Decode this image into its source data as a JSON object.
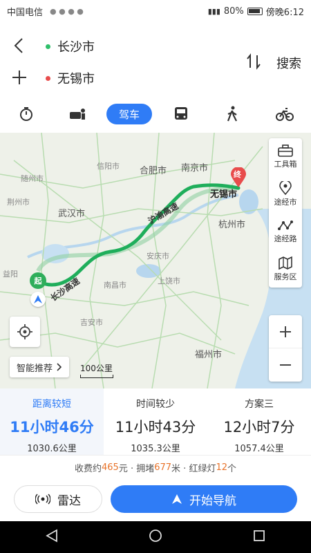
{
  "status_bar": {
    "carrier": "中国电信",
    "battery": "80%",
    "time": "傍晚6:12"
  },
  "route": {
    "origin": "长沙市",
    "destination": "无锡市",
    "search_label": "搜索"
  },
  "modes": {
    "active_label": "驾车",
    "items": [
      "taxi-icon",
      "bus-icon",
      "car",
      "rail-icon",
      "walk-icon",
      "bike-icon"
    ]
  },
  "map": {
    "labels": {
      "hefei": "合肥市",
      "nanjing": "南京市",
      "wuxi": "无锡市",
      "hangzhou": "杭州市",
      "wuhan": "武汉市",
      "fuzhou": "福州市",
      "jingzhou": "荆州市",
      "suizhou": "随州市",
      "xinyang": "信阳市",
      "anqing": "安庆市",
      "shangrao": "上饶市",
      "jian": "吉安市",
      "nanchang": "南昌市",
      "yiyang": "益阳",
      "end_marker": "终",
      "start_marker": "起"
    },
    "road_labels": [
      "沪渝高速",
      "长沙高速"
    ],
    "tools": [
      {
        "label": "工具箱",
        "icon": "toolbox-icon"
      },
      {
        "label": "途经市",
        "icon": "location-pin-icon"
      },
      {
        "label": "途经路",
        "icon": "route-nodes-icon"
      },
      {
        "label": "服务区",
        "icon": "service-area-icon"
      }
    ],
    "smart_recommend": "智能推荐",
    "scale_label": "100公里",
    "route_color": "#1fae5b"
  },
  "options": [
    {
      "label": "距离较短",
      "time": "11小时46分",
      "distance": "1030.6公里",
      "selected": true
    },
    {
      "label": "时间较少",
      "time": "11小时43分",
      "distance": "1035.3公里",
      "selected": false
    },
    {
      "label": "方案三",
      "time": "12小时7分",
      "distance": "1057.4公里",
      "selected": false
    }
  ],
  "info": {
    "toll_prefix": "收费约",
    "toll_value": "465",
    "toll_unit": "元 · 拥堵",
    "jam_value": "677",
    "jam_unit": "米 · 红绿灯",
    "lights_value": "12",
    "lights_unit": "个"
  },
  "actions": {
    "radar_label": "雷达",
    "navigate_label": "开始导航"
  },
  "colors": {
    "primary": "#2f7cf6",
    "route_green": "#1fae5b",
    "highlight_orange": "#e8732a",
    "dest_red": "#e84c4c"
  }
}
